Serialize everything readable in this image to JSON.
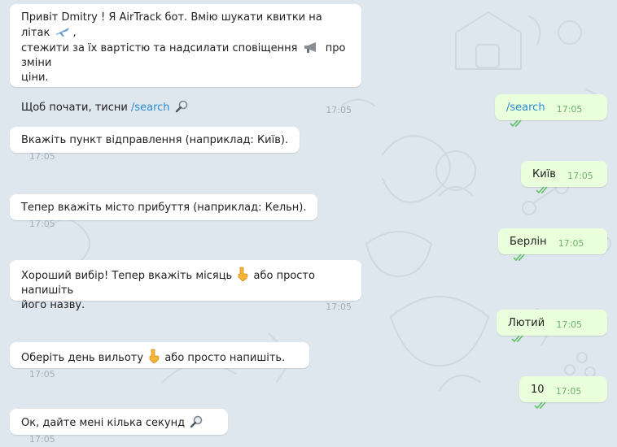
{
  "colors": {
    "background": "#dfe7ee",
    "incoming_bubble": "#ffffff",
    "outgoing_bubble": "#eaffdc",
    "link": "#2a8bd2",
    "time_incoming": "#a0acb6",
    "time_outgoing": "#6bb36a"
  },
  "messages": {
    "m1": {
      "line1": "Привіт Dmitry ! Я AirTrack бот. Вмію шукати квитки на літак",
      "line2": "стежити за їх вартістю та надсилати сповіщення",
      "line2b": "про зміни",
      "line3": "ціни.",
      "line4_prefix": "Щоб почати, тисни ",
      "line4_link": "/search",
      "time": "17:05",
      "icons": [
        "airplane-icon",
        "megaphone-icon",
        "magnifier-icon"
      ]
    },
    "m2": {
      "text": "/search",
      "time": "17:05"
    },
    "m3": {
      "text": "Вкажіть пункт відправлення (наприклад: Київ).",
      "time": "17:05"
    },
    "m4": {
      "text": "Київ",
      "time": "17:05"
    },
    "m5": {
      "text": "Тепер вкажіть місто прибуття (наприклад: Кельн).",
      "time": "17:05"
    },
    "m6": {
      "text": "Берлін",
      "time": "17:05"
    },
    "m7": {
      "line1a": "Хороший вибір! Тепер вкажіть місяць",
      "line1b": "або просто напишіть",
      "line2": "його назву.",
      "time": "17:05",
      "icons": [
        "pointing-down-icon"
      ]
    },
    "m8": {
      "text": "Лютий",
      "time": "17:05"
    },
    "m9": {
      "text_a": "Оберіть день вильоту",
      "text_b": "або просто напишіть.",
      "time": "17:05",
      "icons": [
        "pointing-down-icon"
      ]
    },
    "m10": {
      "text": "10",
      "time": "17:05"
    },
    "m11": {
      "text": "Ок, дайте мені кілька секунд",
      "time": "17:05",
      "icons": [
        "magnifier-icon"
      ]
    }
  }
}
